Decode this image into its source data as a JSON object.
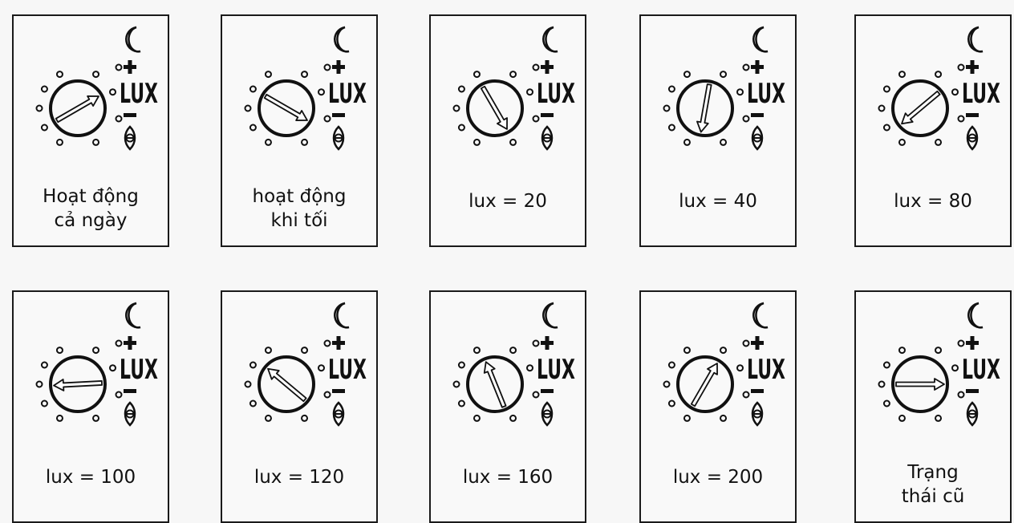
{
  "lux_label": "LUX",
  "cards": [
    {
      "caption": "Hoạt động\ncả ngày",
      "dial_angle_deg": -30
    },
    {
      "caption": "hoạt động\nkhi tối",
      "dial_angle_deg": 30
    },
    {
      "caption": "lux = 20",
      "dial_angle_deg": 60
    },
    {
      "caption": "lux = 40",
      "dial_angle_deg": 100
    },
    {
      "caption": "lux = 80",
      "dial_angle_deg": 140
    },
    {
      "caption": "lux = 100",
      "dial_angle_deg": 177
    },
    {
      "caption": "lux = 120",
      "dial_angle_deg": -140
    },
    {
      "caption": "lux = 160",
      "dial_angle_deg": -112
    },
    {
      "caption": "lux = 200",
      "dial_angle_deg": -60
    },
    {
      "caption": "Trạng\nthái cũ",
      "dial_angle_deg": 0
    }
  ]
}
